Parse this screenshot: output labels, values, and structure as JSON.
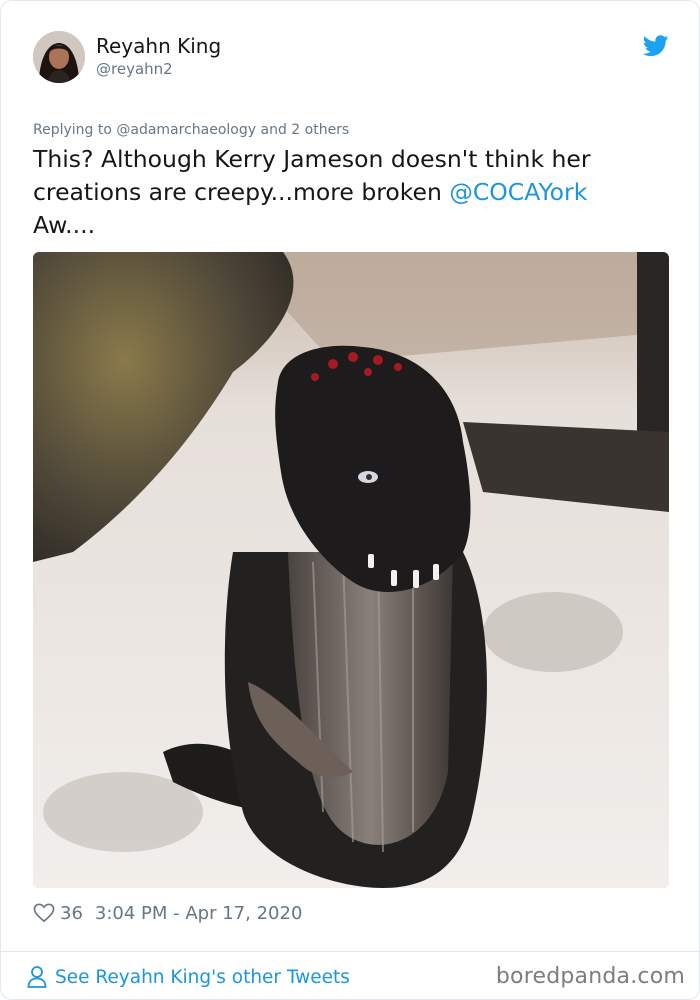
{
  "tweet": {
    "author_name": "Reyahn King",
    "author_handle": "@reyahn2",
    "replying_to": "Replying to @adamarchaeology and 2 others",
    "text_part1": "This? Although Kerry Jameson doesn't think her creations are creepy...more broken ",
    "mention": "@COCAYork",
    "text_part2": "Aw....",
    "like_count": "36",
    "timestamp": "3:04 PM - Apr 17, 2020"
  },
  "footer": {
    "see_more_label": "See Reyahn King's other Tweets",
    "watermark": "boredpanda.com"
  },
  "icons": {
    "brand": "twitter-bird-icon",
    "like": "heart-icon",
    "profile": "person-icon"
  },
  "colors": {
    "link": "#1b95e0",
    "secondary_text": "#657786",
    "border": "#e1e8ed"
  }
}
